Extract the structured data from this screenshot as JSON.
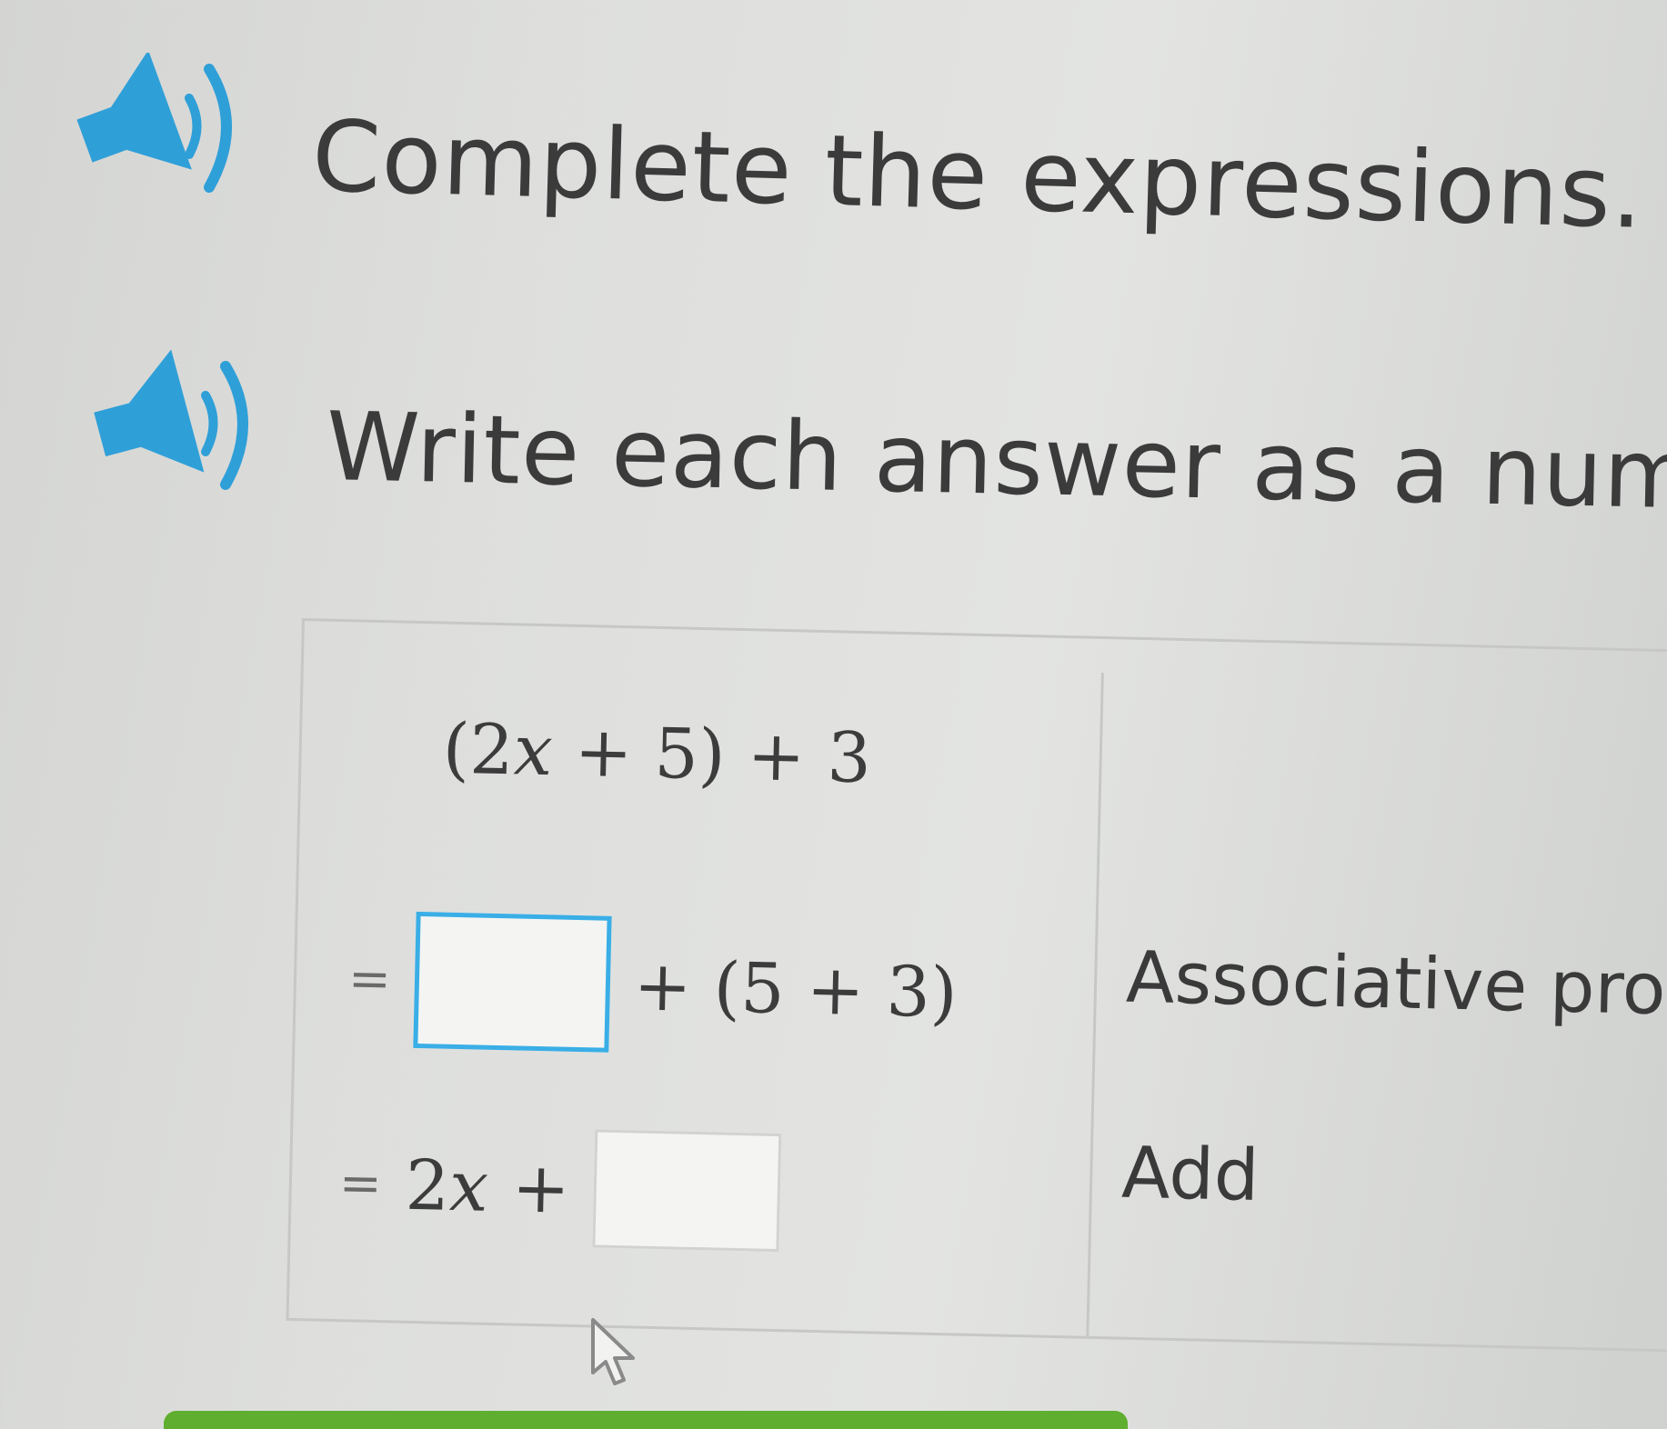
{
  "instructions": {
    "title": "Complete the expressions.",
    "subtitle": "Write each answer as a num"
  },
  "steps": [
    {
      "expr_parts": [
        "(2",
        "x",
        " + 5) + 3"
      ],
      "reason": ""
    },
    {
      "prefix": "=",
      "answer_value": "",
      "suffix": "+ (5 + 3)",
      "reason": "Associative pro"
    },
    {
      "prefix": "=",
      "lead_num": "2",
      "lead_var": "x",
      "plus": "+",
      "answer_value": "",
      "reason": "Add"
    }
  ],
  "colors": {
    "accent_blue": "#3aaee6",
    "progress_green": "#5fae2f"
  },
  "icons": {
    "audio": "speaker-icon",
    "pointer": "mouse-pointer-icon"
  }
}
